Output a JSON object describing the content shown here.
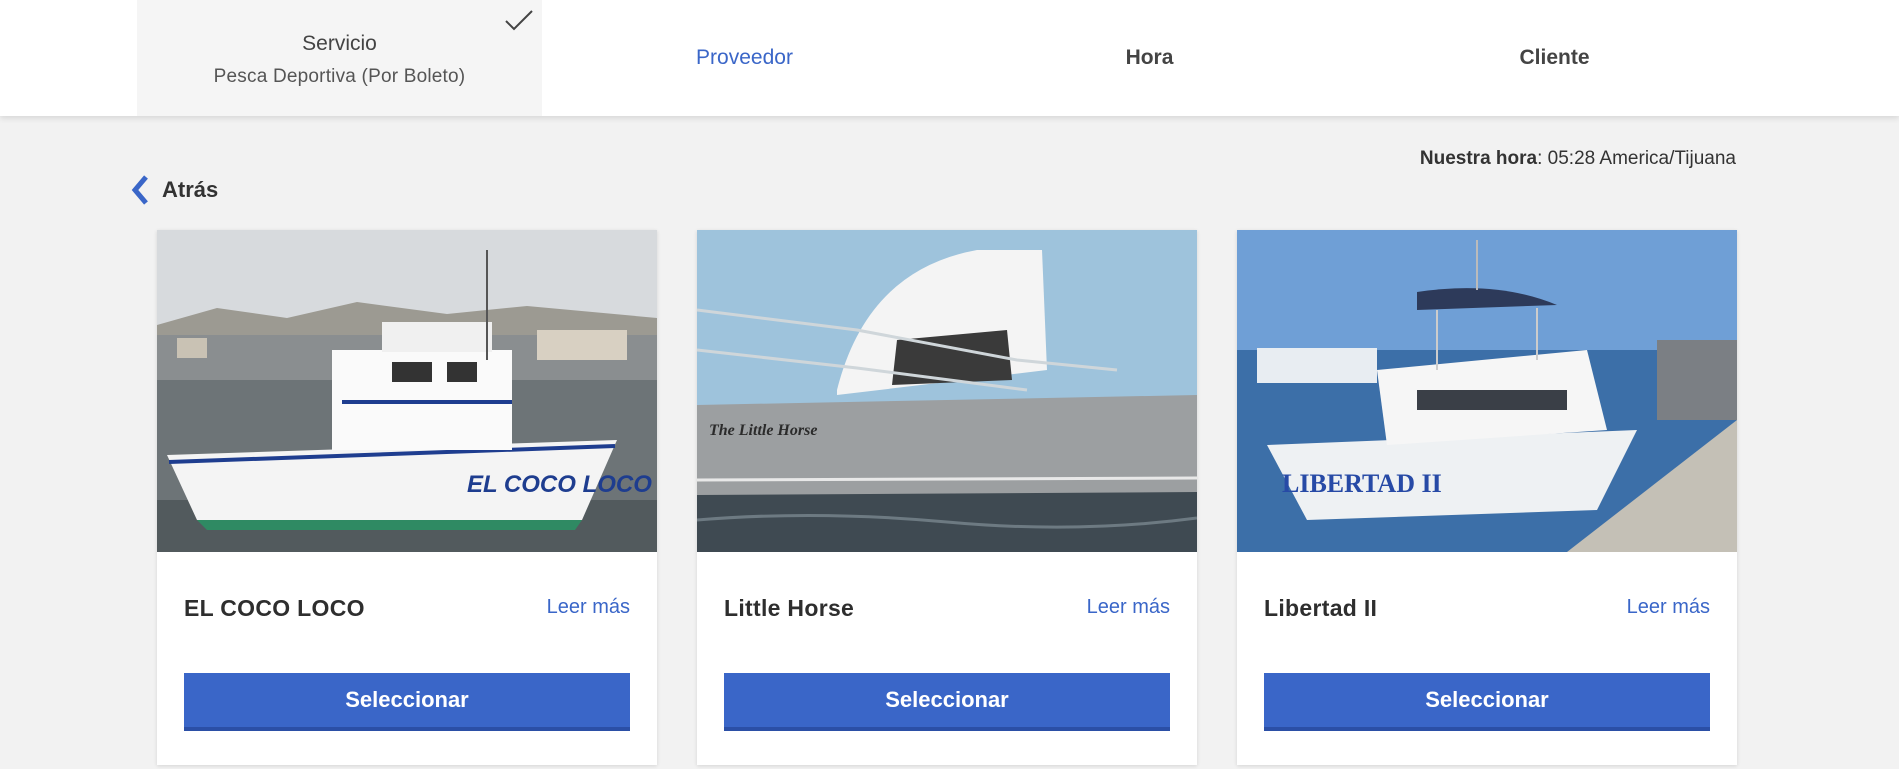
{
  "stepper": {
    "steps": [
      {
        "label": "Servicio",
        "value": "Pesca Deportiva (Por Boleto)",
        "state": "done"
      },
      {
        "label": "Proveedor",
        "state": "active"
      },
      {
        "label": "Hora",
        "state": "pending"
      },
      {
        "label": "Cliente",
        "state": "pending"
      }
    ]
  },
  "nav": {
    "back_label": "Atrás"
  },
  "clock": {
    "label": "Nuestra hora",
    "value": ": 05:28 America/Tijuana"
  },
  "providers": [
    {
      "name": "EL COCO LOCO",
      "read_more": "Leer más",
      "button": "Seleccionar",
      "hull_text": "EL COCO LOCO"
    },
    {
      "name": "Little Horse",
      "read_more": "Leer más",
      "button": "Seleccionar",
      "hull_text": "The Little Horse"
    },
    {
      "name": "Libertad II",
      "read_more": "Leer más",
      "button": "Seleccionar",
      "hull_text": "LIBERTAD II"
    }
  ],
  "colors": {
    "accent": "#3a66c8",
    "background": "#f2f2f2",
    "card": "#ffffff"
  }
}
